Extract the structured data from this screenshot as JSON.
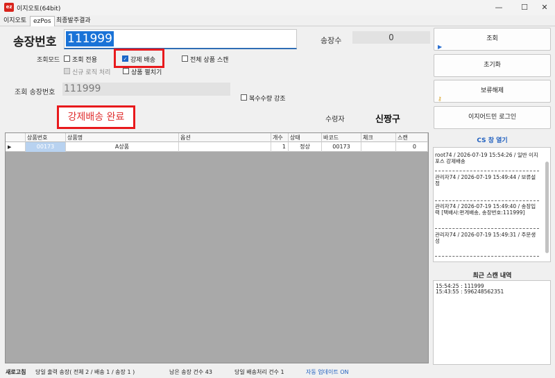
{
  "window": {
    "icon_text": "ez",
    "title": "이지오토(64bit)",
    "controls": {
      "minimize": "—",
      "maximize": "☐",
      "close": "✕"
    }
  },
  "tabs": [
    "이지오토",
    "ezPos",
    "최종발주결과"
  ],
  "form": {
    "invoice_label": "송장번호",
    "invoice_value": "111999",
    "count_label": "송장수",
    "count_value": "0",
    "mode_label": "조회모드",
    "options": {
      "lookup_only": "조회 전용",
      "force_ship": "강제 배송",
      "scan_all": "전체 상품 스캔",
      "new_logic": "신규 로직 처리",
      "product_expand": "상품 펼치기",
      "multi_qty": "복수수량 강조"
    },
    "lookup_label": "조회 송장번호",
    "lookup_value": "111999",
    "done_text": "강제배송 완료",
    "receiver_label": "수령자",
    "receiver_name": "신짱구"
  },
  "grid": {
    "headers": [
      "상품번호",
      "상품명",
      "옵션",
      "개수",
      "상태",
      "바코드",
      "체크",
      "스캔"
    ],
    "row": {
      "marker": "▶",
      "product_no": "00173",
      "name": "A상품",
      "option": "",
      "qty": "1",
      "status": "정상",
      "barcode": "00173",
      "check": "",
      "scan": "0"
    }
  },
  "sidebar": {
    "buttons": [
      "조회",
      "초기화",
      "보류해제",
      "이지어드민 로그인"
    ],
    "cs_title": "CS 창 열기",
    "logs": [
      "root74 / 2026-07-19 15:54:26 / 일반 이지포스 강제배송",
      "관리자74 / 2026-07-19 15:49:44 / 보류설정",
      "관리자74 / 2026-07-19 15:49:40 / 송장입력 [택배사:편게배송, 송장번호:111999]",
      "관리자74 / 2026-07-19 15:49:31 / 주문생성"
    ],
    "recent_title": "최근 스캔 내역",
    "recent": [
      "15:54:25 : 111999",
      "15:43:55 : 596248562351"
    ]
  },
  "status": {
    "refresh": "새로고침",
    "today_output": "당일 출력 송장( 전체 2 / 배송 1 / 송장 1 )",
    "remaining": "남은 송장 건수 43",
    "today_ship": "당일 배송처리 건수 1",
    "auto_update": "자동 업데이트 ON"
  },
  "colors": {
    "highlight": "#e8191c",
    "accent": "#1f5fbf",
    "selection": "#1a73d7"
  }
}
